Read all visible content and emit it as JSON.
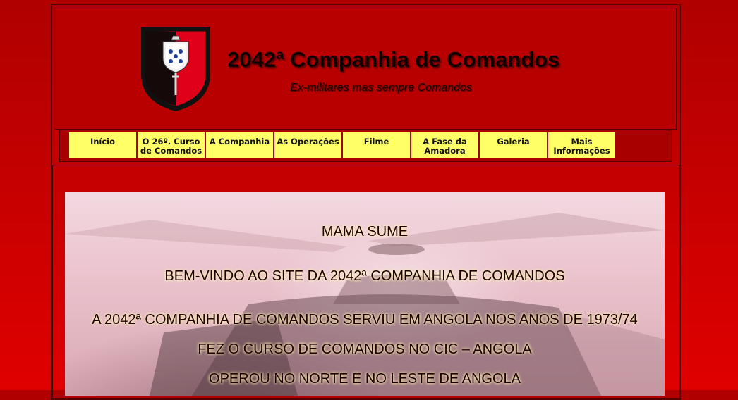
{
  "header": {
    "title": "2042ª Companhia de Comandos",
    "subtitle": "Ex-militares mas sempre Comandos",
    "logo_icon": "comandos-crest-shield-icon"
  },
  "nav": {
    "items": [
      {
        "label": "Início"
      },
      {
        "label": "O 26º. Curso de Comandos"
      },
      {
        "label": "A Companhia"
      },
      {
        "label": "As Operações"
      },
      {
        "label": "Filme"
      },
      {
        "label": "A Fase da Amadora"
      },
      {
        "label": "Galeria"
      },
      {
        "label": "Mais Informações"
      }
    ]
  },
  "content": {
    "lines": [
      "MAMA SUME",
      "BEM-VINDO AO SITE DA 2042ª COMPANHIA DE COMANDOS",
      "A 2042ª COMPANHIA DE COMANDOS SERVIU EM ANGOLA NOS ANOS DE 1973/74",
      "FEZ O CURSO DE COMANDOS NO CIC – ANGOLA",
      "OPEROU NO NORTE E NO LESTE DE ANGOLA"
    ]
  },
  "colors": {
    "page_background": "#c00000",
    "header_background": "#b80000",
    "nav_button": "#ffff66",
    "text": "#1a0000"
  }
}
